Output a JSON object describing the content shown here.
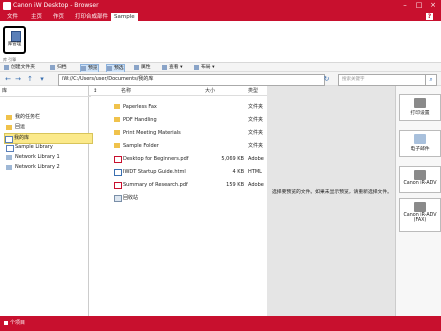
{
  "window": {
    "title": "Canon iW Desktop - Browser"
  },
  "ribbon_tabs": [
    "文件",
    "主页",
    "作页",
    "打印合成部件",
    "Sample"
  ],
  "ribbon": {
    "library_manager_label": "库管理",
    "group_label": "库 引擎"
  },
  "toolbar": {
    "new_folder": "创建文件夹",
    "delete": "归档",
    "preview": "预览",
    "select": "预选",
    "properties": "属性",
    "view": "查看",
    "arrange": "布局"
  },
  "address": {
    "path": "iW://C:/Users/user/Documents/我的库",
    "search_placeholder": "搜索关键字"
  },
  "left_pane": {
    "header": "库",
    "items": [
      "我的任务栏",
      "回运",
      "我的库",
      "Sample Library",
      "Network Library 1",
      "Network Library 2"
    ]
  },
  "file_list": {
    "columns": {
      "name": "名称",
      "size": "大小",
      "type": "类型"
    },
    "rows": [
      {
        "icon": "folder",
        "name": "Paperless Fax",
        "size": "",
        "type": "文件夹"
      },
      {
        "icon": "folder",
        "name": "PDF Handling",
        "size": "",
        "type": "文件夹"
      },
      {
        "icon": "folder",
        "name": "Print Meeting Materials",
        "size": "",
        "type": "文件夹"
      },
      {
        "icon": "folder",
        "name": "Sample Folder",
        "size": "",
        "type": "文件夹"
      },
      {
        "icon": "pdf",
        "name": "Desktop for Beginners.pdf",
        "size": "5,069 KB",
        "type": "Adobe"
      },
      {
        "icon": "html",
        "name": "IWDT Startup Guide.html",
        "size": "4 KB",
        "type": "HTML"
      },
      {
        "icon": "pdf",
        "name": "Summary of Research.pdf",
        "size": "159 KB",
        "type": "Adobe"
      },
      {
        "icon": "recycle",
        "name": "回收站",
        "size": "",
        "type": ""
      }
    ]
  },
  "preview": {
    "message": "选择要预览的文件。如果未显示预览，请重新选择文件。"
  },
  "right_panel": {
    "buttons": [
      "打印设置",
      "电子邮件",
      "Canon iR-ADV",
      "Canon iR-ADV (FAX)"
    ]
  },
  "status": {
    "text": "个项目"
  },
  "colors": {
    "accent": "#c8102e",
    "selection": "#fbe98a"
  }
}
